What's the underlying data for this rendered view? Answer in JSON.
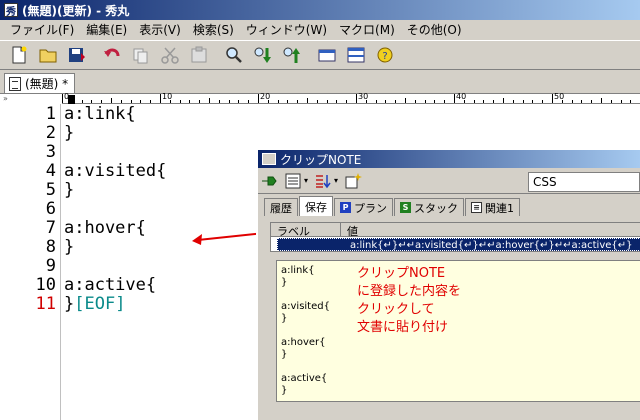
{
  "window": {
    "title": "(無題)(更新) - 秀丸"
  },
  "menu": [
    "ファイル(F)",
    "編集(E)",
    "表示(V)",
    "検索(S)",
    "ウィンドウ(W)",
    "マクロ(M)",
    "その他(O)"
  ],
  "tab": {
    "label": "(無題) *"
  },
  "ruler": {
    "marks": [
      "0",
      "10",
      "20",
      "30",
      "40",
      "50"
    ]
  },
  "editor": {
    "lines": [
      {
        "n": "1",
        "text": "a:link{"
      },
      {
        "n": "2",
        "text": "}"
      },
      {
        "n": "3",
        "text": ""
      },
      {
        "n": "4",
        "text": "a:visited{"
      },
      {
        "n": "5",
        "text": "}"
      },
      {
        "n": "6",
        "text": ""
      },
      {
        "n": "7",
        "text": "a:hover{"
      },
      {
        "n": "8",
        "text": "}"
      },
      {
        "n": "9",
        "text": ""
      },
      {
        "n": "10",
        "text": "a:active{"
      },
      {
        "n": "11",
        "text": "}"
      }
    ],
    "eof": "[EOF]"
  },
  "clip": {
    "title": "クリップNOTE",
    "search_value": "CSS",
    "tabs": [
      "履歴",
      "保存",
      "プラン",
      "スタック",
      "関連1"
    ],
    "columns": {
      "label": "ラベル",
      "value": "値"
    },
    "row_value": "a:link{↵}↵↵a:visited{↵}↵↵a:hover{↵}↵↵a:active{↵}",
    "preview_lines": [
      "a:link{",
      "}",
      "",
      "a:visited{",
      "}",
      "",
      "a:hover{",
      "}",
      "",
      "a:active{",
      "}"
    ],
    "callout": [
      "クリップNOTE",
      "に登録した内容を",
      "クリックして",
      "文書に貼り付け"
    ]
  },
  "colors": {
    "title_bar": "#0a246a",
    "current_line_number": "#d00000",
    "eof": "#0a8a8a",
    "callout": "#e00000",
    "selection": "#0a246a",
    "preview_bg": "#ffffe0"
  }
}
